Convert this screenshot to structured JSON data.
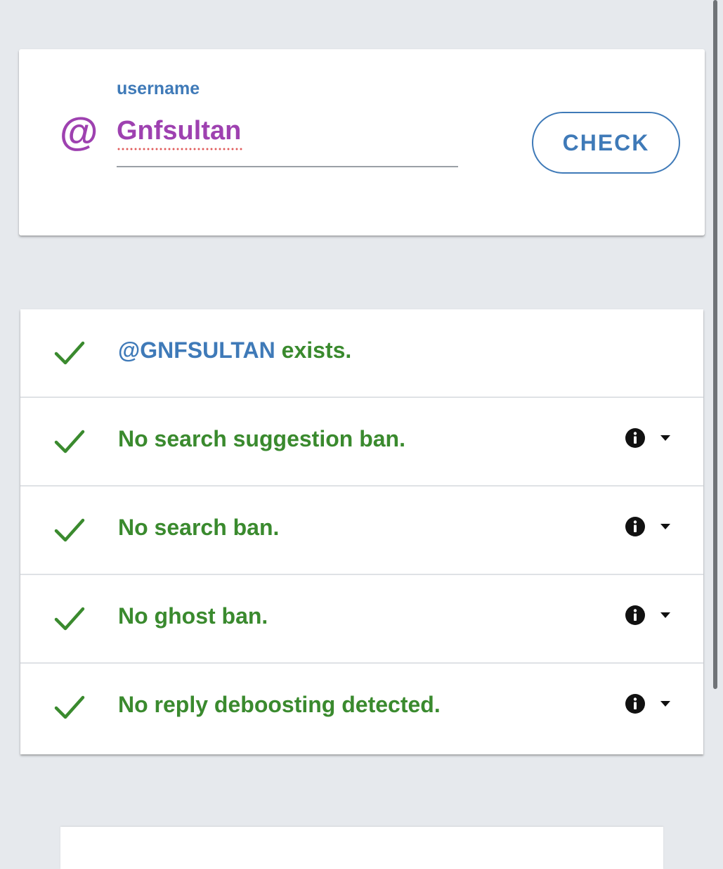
{
  "search": {
    "at_symbol": "@",
    "label": "username",
    "value": "Gnfsultan",
    "button_label": "CHECK"
  },
  "results": [
    {
      "handle": "@GNFSULTAN",
      "text": " exists.",
      "status": "ok",
      "has_info": false
    },
    {
      "handle": "",
      "text": "No search suggestion ban.",
      "status": "ok",
      "has_info": true
    },
    {
      "handle": "",
      "text": "No search ban.",
      "status": "ok",
      "has_info": true
    },
    {
      "handle": "",
      "text": "No ghost ban.",
      "status": "ok",
      "has_info": true
    },
    {
      "handle": "",
      "text": "No reply deboosting detected.",
      "status": "ok",
      "has_info": true
    }
  ],
  "icons": {
    "check": "check-icon",
    "info": "info-icon",
    "dropdown": "arrow-drop-down-icon",
    "at": "at-sign-icon"
  },
  "colors": {
    "accent_blue": "#3f7ab8",
    "purple": "#9e41b0",
    "success_green": "#3a8a2e",
    "background": "#e6e9ed"
  }
}
